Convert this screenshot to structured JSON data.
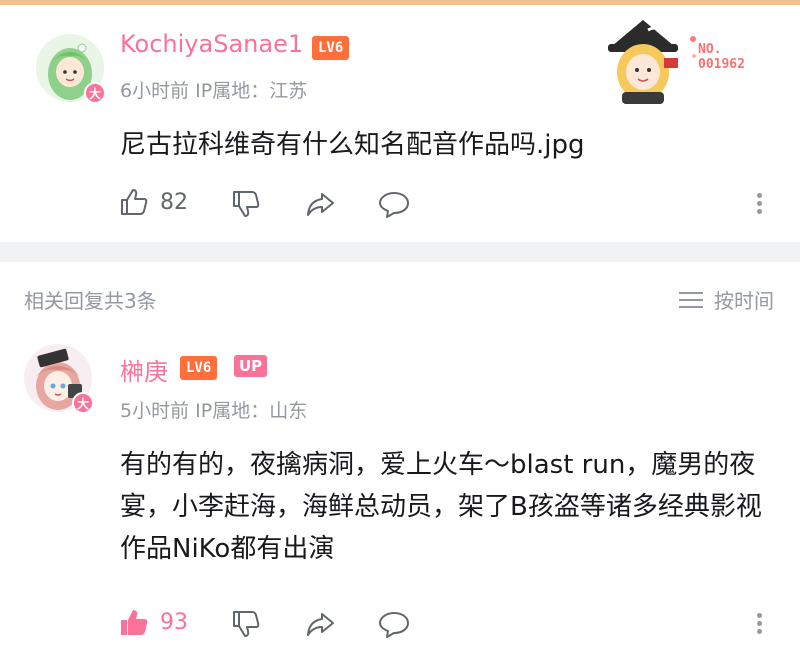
{
  "colors": {
    "accent": "#fb7299",
    "level": "#ff6f3c",
    "muted": "#9499a0",
    "topbar": "#f3c18f"
  },
  "main_comment": {
    "username": "KochiyaSanae1",
    "level": "LV6",
    "vip_badge": "大",
    "meta": "6小时前  IP属地：江苏",
    "content": "尼古拉科维奇有什么知名配音作品吗.jpg",
    "likes": "82",
    "sticker_no_label": "NO.",
    "sticker_no_value": "001962"
  },
  "replies_header": {
    "title": "相关回复共3条",
    "sort_label": "按时间"
  },
  "reply": {
    "username": "榊庚",
    "level": "LV6",
    "up_badge": "UP",
    "vip_badge": "大",
    "meta": "5小时前  IP属地：山东",
    "content": "有的有的，夜擒病洞，爱上火车～blast run，魔男的夜宴，小李赶海，海鲜总动员，架了B孩盗等诸多经典影视作品NiKo都有出演",
    "likes": "93",
    "liked": true
  },
  "icons": [
    "thumb-up-icon",
    "thumb-down-icon",
    "share-icon",
    "comment-icon",
    "more-icon",
    "sort-icon"
  ]
}
